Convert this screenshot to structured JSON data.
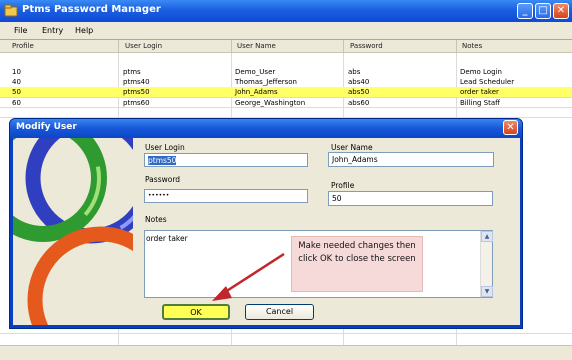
{
  "window": {
    "title": "Ptms Password Manager",
    "controls": {
      "minimize": "_",
      "maximize": "□",
      "close": "✕"
    }
  },
  "menu": [
    "File",
    "Entry",
    "Help"
  ],
  "grid": {
    "columns": [
      "Profile",
      "User Login",
      "User Name",
      "Password",
      "Notes"
    ],
    "rows": [
      {
        "profile": "10",
        "login": "ptms",
        "name": "Demo_User",
        "password": "abs",
        "notes": "Demo Login",
        "selected": false
      },
      {
        "profile": "40",
        "login": "ptms40",
        "name": "Thomas_Jefferson",
        "password": "abs40",
        "notes": "Lead Scheduler",
        "selected": false
      },
      {
        "profile": "50",
        "login": "ptms50",
        "name": "John_Adams",
        "password": "abs50",
        "notes": "order taker",
        "selected": true
      },
      {
        "profile": "60",
        "login": "ptms60",
        "name": "George_Washington",
        "password": "abs60",
        "notes": "Billing Staff",
        "selected": false
      }
    ],
    "selected_color": "#ffff66"
  },
  "dialog": {
    "title": "Modify User",
    "close": "✕",
    "user_login": {
      "label": "User Login",
      "value": "ptms50"
    },
    "user_name": {
      "label": "User Name",
      "value": "John_Adams"
    },
    "password": {
      "label": "Password",
      "value": "••••••"
    },
    "profile": {
      "label": "Profile",
      "value": "50"
    },
    "notes": {
      "label": "Notes",
      "value": "order taker"
    },
    "ok_label": "OK",
    "cancel_label": "Cancel"
  },
  "callout": {
    "text": "Make needed changes then click OK to close the screen",
    "arrow_color": "#c0262b"
  },
  "colors": {
    "titlebar": "#1b5fe0",
    "dialog_frame": "#0a3fbf",
    "highlight": "#ffff55"
  }
}
